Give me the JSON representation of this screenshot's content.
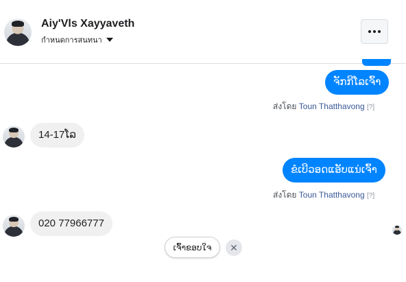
{
  "header": {
    "contact_name": "Aiy'Vls Xayyaveth",
    "subtitle": "กำหนดการสนทนา",
    "menu_icon": "more-horizontal-icon"
  },
  "messages": [
    {
      "direction": "outgoing",
      "text": "ຈັກກີໂລເຈົ້າ",
      "sent_by_prefix": "ส่งโดย",
      "sent_by_name": "Toun Thatthavong",
      "help": "[?]"
    },
    {
      "direction": "incoming",
      "text": "14-17ໂລ"
    },
    {
      "direction": "outgoing",
      "text": "ຂໍເບີວອດແອັບແນ່ເຈົ້າ",
      "sent_by_prefix": "ส่งโดย",
      "sent_by_name": "Toun Thatthavong",
      "help": "[?]"
    },
    {
      "direction": "incoming",
      "text": "020 77966777"
    }
  ],
  "quick_reply": {
    "label": "ເຈົ້າຂອບໃຈ",
    "close_symbol": "✕"
  },
  "colors": {
    "outgoing_bubble": "#0084ff",
    "incoming_bubble": "#f0f0f0",
    "sender_link": "#385898"
  }
}
